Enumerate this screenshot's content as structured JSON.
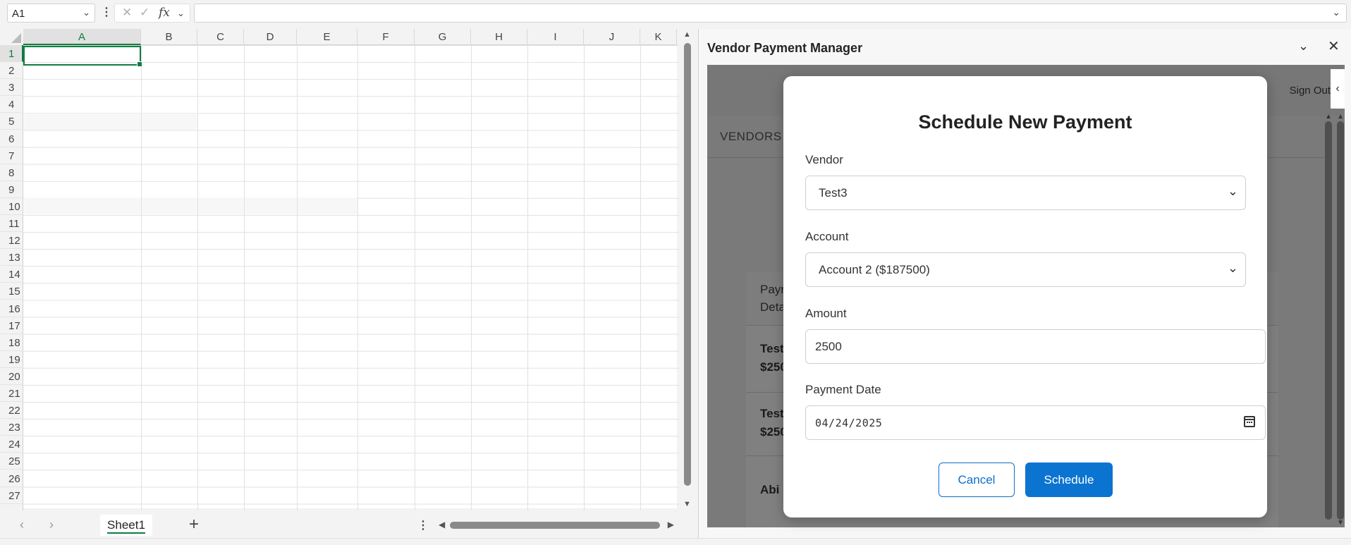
{
  "formula_bar": {
    "name_box": "A1",
    "fx_label": "fx",
    "formula_value": ""
  },
  "grid": {
    "columns": [
      "A",
      "B",
      "C",
      "D",
      "E",
      "F",
      "G",
      "H",
      "I",
      "J",
      "K"
    ],
    "rows": [
      "1",
      "2",
      "3",
      "4",
      "5",
      "6",
      "7",
      "8",
      "9",
      "10",
      "11",
      "12",
      "13",
      "14",
      "15",
      "16",
      "17",
      "18",
      "19",
      "20",
      "21",
      "22",
      "23",
      "24",
      "25",
      "26",
      "27"
    ],
    "selected_cell": "A1"
  },
  "sheet_tabs": {
    "tabs": [
      "Sheet1"
    ],
    "add_label": "+"
  },
  "task_pane": {
    "title": "Vendor Payment Manager",
    "sign_out": "Sign Out",
    "vendors_tab": "VENDORS",
    "background_table": {
      "header": [
        "Payr",
        "Deta"
      ],
      "rows": [
        [
          "Test",
          "$250"
        ],
        [
          "Test",
          "$250"
        ],
        [
          "Abi"
        ]
      ]
    }
  },
  "modal": {
    "title": "Schedule New Payment",
    "vendor_label": "Vendor",
    "vendor_value": "Test3",
    "account_label": "Account",
    "account_value": "Account 2 ($187500)",
    "amount_label": "Amount",
    "amount_value": "2500",
    "date_label": "Payment Date",
    "date_value": "04/24/2025",
    "cancel_label": "Cancel",
    "schedule_label": "Schedule"
  },
  "colors": {
    "excel_green": "#107c41",
    "primary_button": "#0b74d1",
    "overlay": "#7a7a7a"
  }
}
